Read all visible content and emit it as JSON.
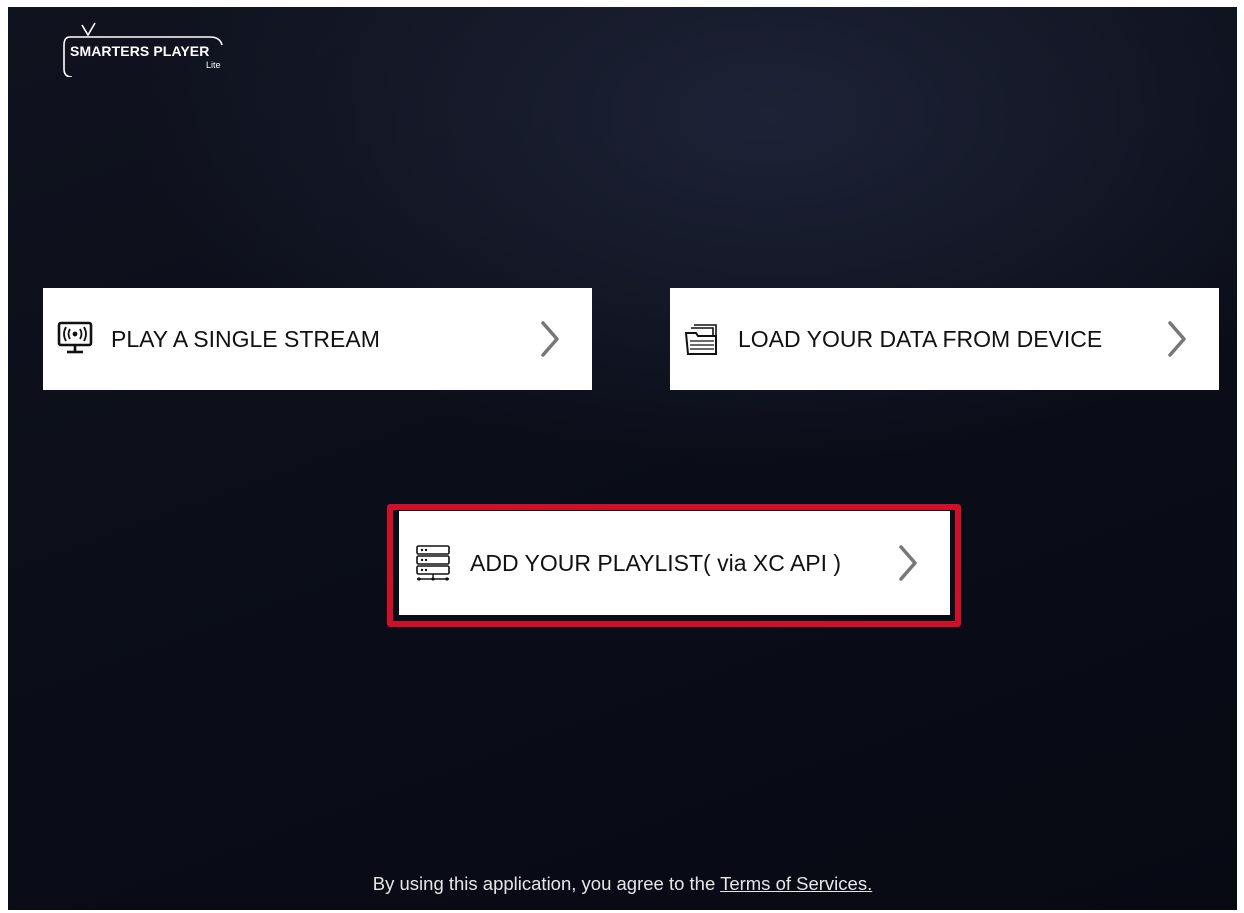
{
  "app": {
    "logo_title": "SMARTERS PLAYER",
    "logo_subtitle": "Lite"
  },
  "options": [
    {
      "label": "PLAY A SINGLE STREAM",
      "icon": "broadcast-tv-icon"
    },
    {
      "label": "LOAD YOUR DATA FROM DEVICE",
      "icon": "folder-files-icon"
    },
    {
      "label": "ADD YOUR PLAYLIST( via XC API )",
      "icon": "server-network-icon",
      "highlighted": true
    }
  ],
  "footer": {
    "text": "By using this application, you agree to the",
    "link": "Terms of Services."
  },
  "colors": {
    "highlight_border": "#d0102a",
    "card_background": "#ffffff",
    "background": "#0b0e19"
  }
}
